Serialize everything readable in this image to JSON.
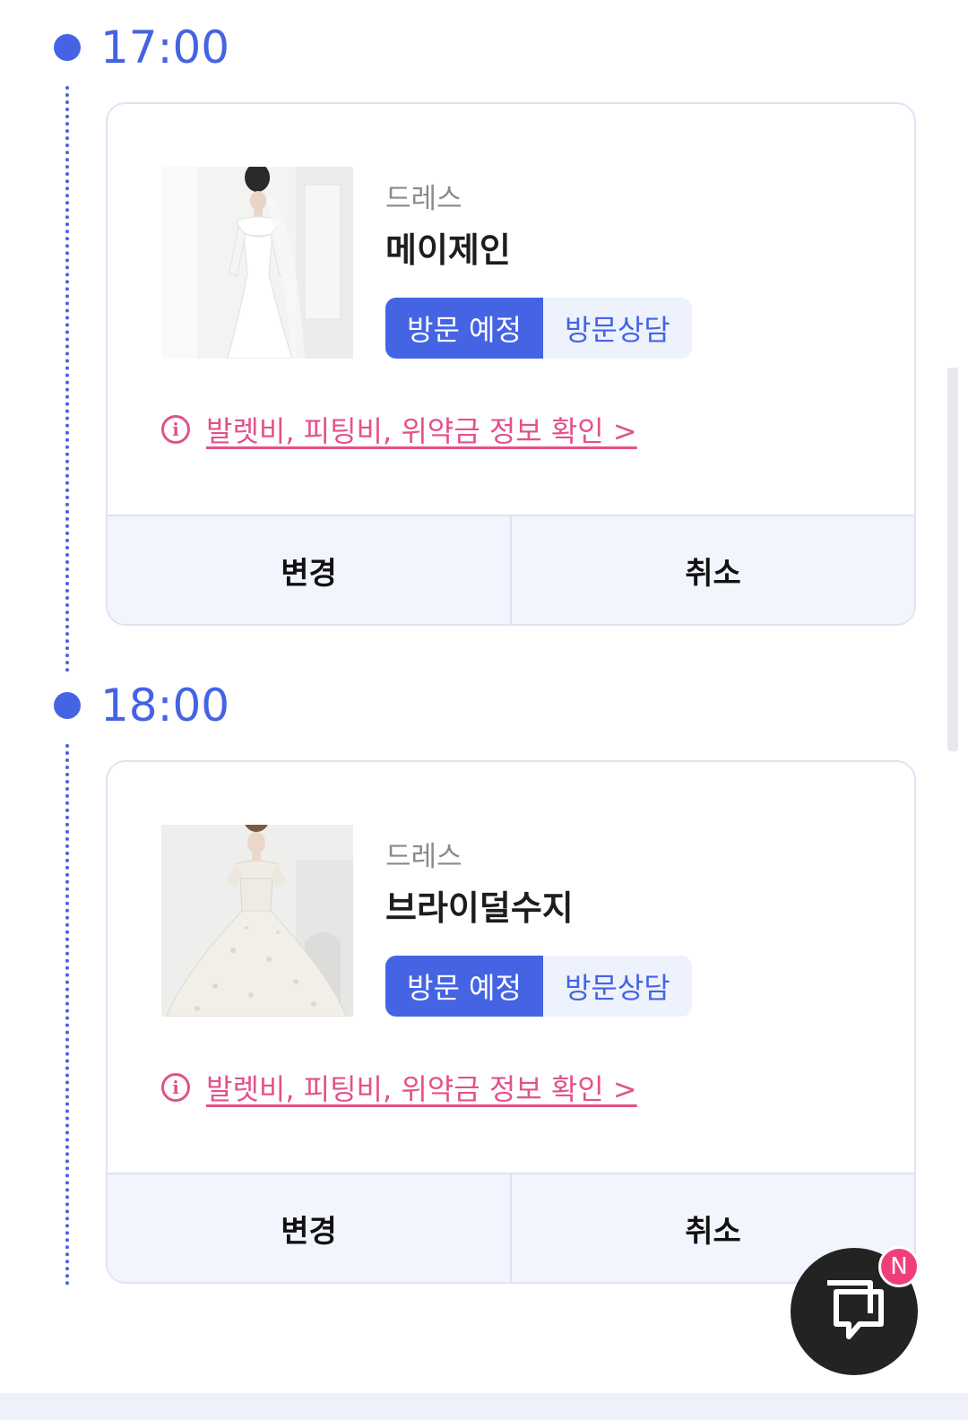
{
  "schedule": [
    {
      "time": "17:00",
      "category": "드레스",
      "shop_name": "메이제인",
      "status_chip": "방문 예정",
      "type_chip": "방문상담",
      "info_link": "발렛비, 피팅비, 위약금 정보 확인 >",
      "change_label": "변경",
      "cancel_label": "취소"
    },
    {
      "time": "18:00",
      "category": "드레스",
      "shop_name": "브라이덜수지",
      "status_chip": "방문 예정",
      "type_chip": "방문상담",
      "info_link": "발렛비, 피팅비, 위약금 정보 확인 >",
      "change_label": "변경",
      "cancel_label": "취소"
    }
  ],
  "chat": {
    "badge": "N",
    "icon": "chat-bubbles-icon"
  },
  "colors": {
    "accent": "#4464e3",
    "link": "#e2528a",
    "badge": "#f03f78"
  }
}
